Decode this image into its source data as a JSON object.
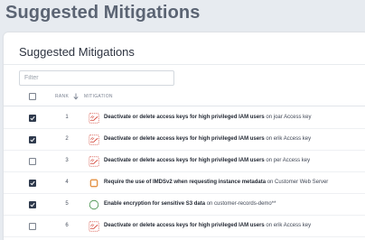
{
  "page_title": "Suggested Mitigations",
  "card": {
    "title": "Suggested Mitigations",
    "filter_placeholder": "Filter"
  },
  "table": {
    "columns": {
      "rank": "RANK",
      "mitigation": "MITIGATION"
    },
    "rows": [
      {
        "checked": true,
        "rank": "1",
        "icon": "iam-policy-icon",
        "action": "Deactivate or delete access keys for high privileged IAM users",
        "on": " on joar Access key"
      },
      {
        "checked": true,
        "rank": "2",
        "icon": "iam-policy-icon",
        "action": "Deactivate or delete access keys for high privileged IAM users",
        "on": " on erik Access key"
      },
      {
        "checked": false,
        "rank": "3",
        "icon": "iam-policy-icon",
        "action": "Deactivate or delete access keys for high privileged IAM users",
        "on": " on per Access key"
      },
      {
        "checked": true,
        "rank": "4",
        "icon": "ec2-instance-icon",
        "action": "Require the use of IMDSv2 when requesting instance metadata",
        "on": " on Customer Web Server"
      },
      {
        "checked": true,
        "rank": "5",
        "icon": "s3-bucket-icon",
        "action": "Enable encryption for sensitive S3 data",
        "on": " on customer-records-demo**"
      },
      {
        "checked": false,
        "rank": "6",
        "icon": "iam-policy-icon",
        "action": "Deactivate or delete access keys for high privileged IAM users",
        "on": " on erik Access key"
      }
    ]
  },
  "colors": {
    "iam": "#d0392b",
    "ec2": "#e0822a",
    "s3": "#3d8a42"
  }
}
